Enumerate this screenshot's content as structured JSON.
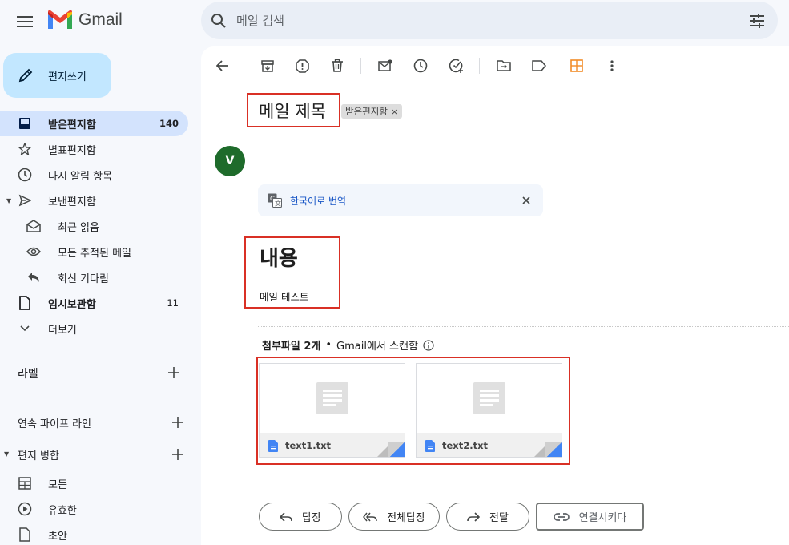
{
  "app": {
    "name": "Gmail"
  },
  "search": {
    "placeholder": "메일 검색"
  },
  "compose": {
    "label": "편지쓰기"
  },
  "sidebar": {
    "items": [
      {
        "label": "받은편지함",
        "count": "140"
      },
      {
        "label": "별표편지함"
      },
      {
        "label": "다시 알림 항목"
      },
      {
        "label": "보낸편지함"
      },
      {
        "label": "최근 읽음"
      },
      {
        "label": "모든 추적된 메일"
      },
      {
        "label": "회신 기다림"
      },
      {
        "label": "임시보관함",
        "count": "11"
      },
      {
        "label": "더보기"
      }
    ],
    "labels_title": "라벨",
    "pipeline_title": "연속 파이프 라인",
    "merge_title": "편지 병합",
    "merge_items": [
      {
        "label": "모든"
      },
      {
        "label": "유효한"
      },
      {
        "label": "초안"
      }
    ]
  },
  "email": {
    "subject": "메일 제목",
    "label_chip": "받은편지함",
    "avatar_letter": "V",
    "translate": "한국어로 번역",
    "body_heading": "내용",
    "body_text": "메일 테스트",
    "attachments_title": "첨부파일 2개",
    "attachments_note": "Gmail에서 스캔함",
    "attachments": [
      {
        "name": "text1.txt"
      },
      {
        "name": "text2.txt"
      }
    ]
  },
  "actions": {
    "reply": "답장",
    "reply_all": "전체답장",
    "forward": "전달",
    "link": "연결시키다"
  },
  "colors": {
    "accent": "#c2e7ff",
    "active_nav": "#d3e3fd",
    "highlight": "#d93025",
    "avatar": "#1e6b2b"
  }
}
